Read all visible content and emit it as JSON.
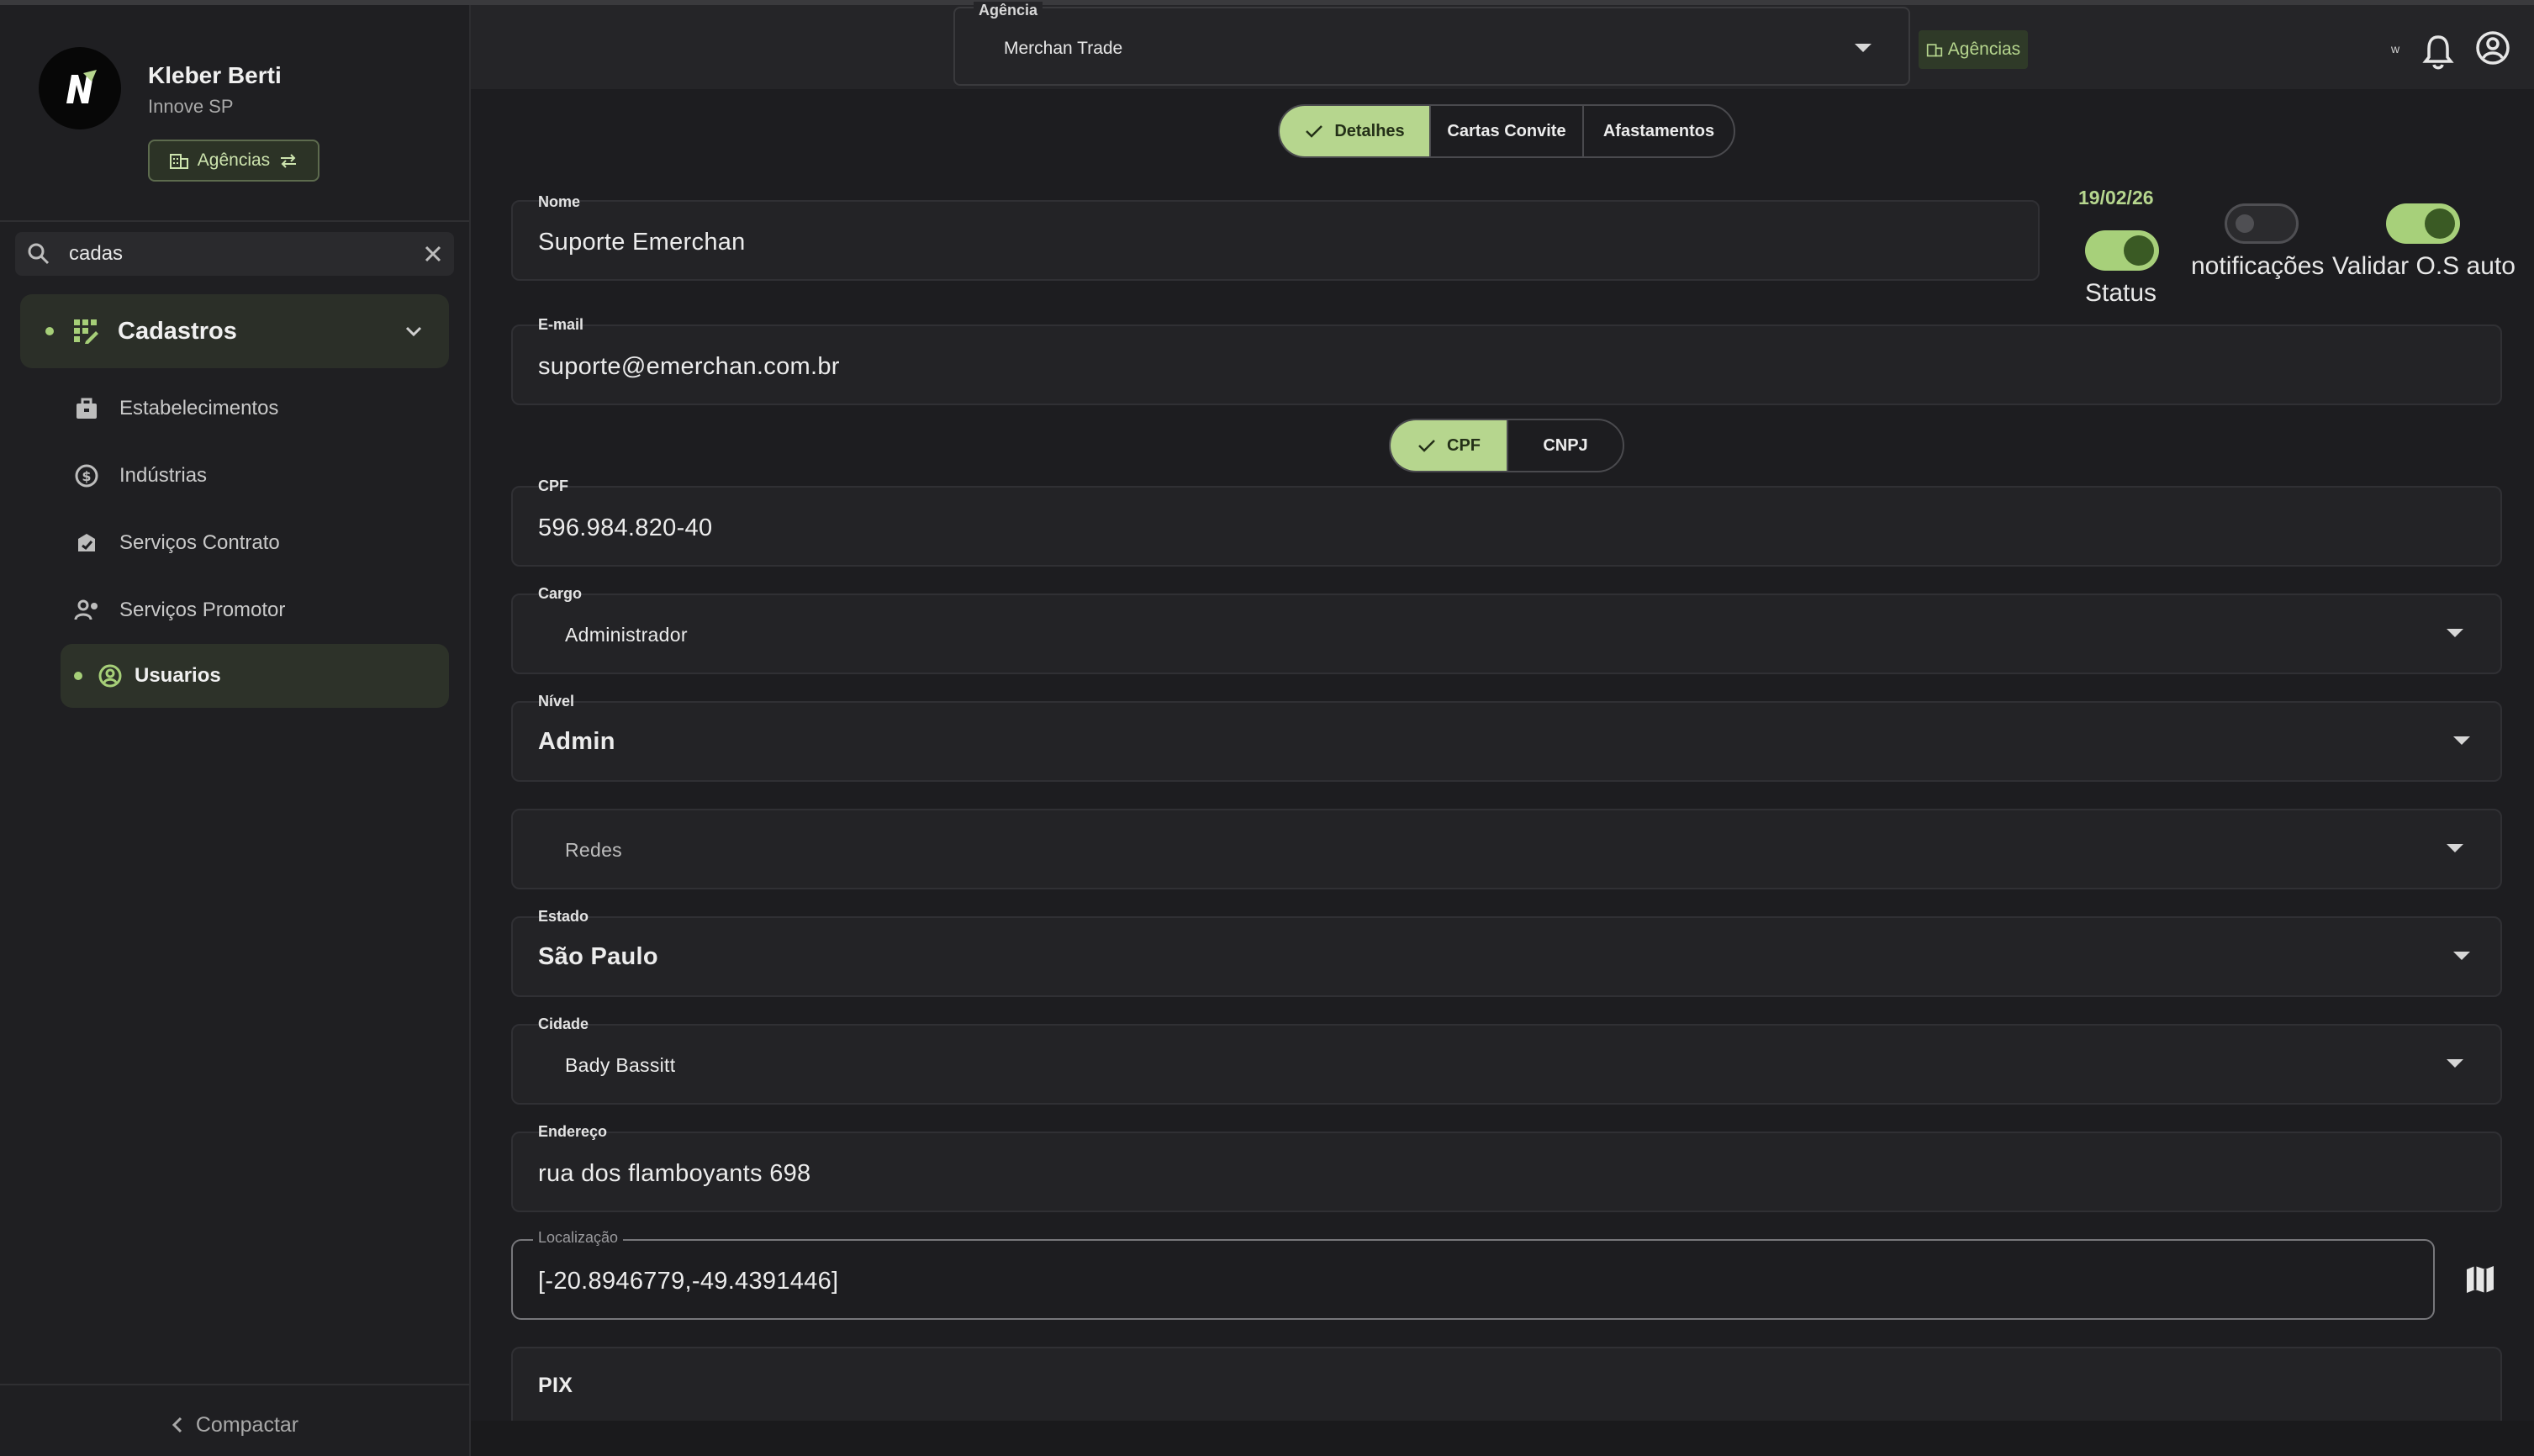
{
  "sidebar": {
    "user_name": "Kleber Berti",
    "user_org": "Innove SP",
    "agencias_chip": "Agências",
    "search_value": "cadas",
    "group_label": "Cadastros",
    "items": [
      {
        "label": "Estabelecimentos",
        "icon": "store-icon"
      },
      {
        "label": "Indústrias",
        "icon": "dollar-circle-icon"
      },
      {
        "label": "Serviços Contrato",
        "icon": "contract-icon"
      },
      {
        "label": "Serviços Promotor",
        "icon": "person-gear-icon"
      }
    ],
    "active_item": "Usuarios",
    "compact_label": "Compactar"
  },
  "header": {
    "agencia_label": "Agência",
    "agencia_value": "Merchan Trade",
    "agencias_button": "Agências",
    "w_label": "w"
  },
  "tabs": {
    "detalhes": "Detalhes",
    "cartas": "Cartas Convite",
    "afastamentos": "Afastamentos"
  },
  "form": {
    "nome_label": "Nome",
    "nome_value": "Suporte Emerchan",
    "date": "19/02/26",
    "status_label": "Status",
    "status_on": true,
    "notificacoes_label": "notificações",
    "notificacoes_on": false,
    "validar_label": "Validar O.S auto",
    "validar_on": true,
    "email_label": "E-mail",
    "email_value": "suporte@emerchan.com.br",
    "doc_cpf": "CPF",
    "doc_cnpj": "CNPJ",
    "cpf_label": "CPF",
    "cpf_value": "596.984.820-40",
    "cargo_label": "Cargo",
    "cargo_value": "Administrador",
    "nivel_label": "Nível",
    "nivel_value": "Admin",
    "redes_placeholder": "Redes",
    "estado_label": "Estado",
    "estado_value": "São Paulo",
    "cidade_label": "Cidade",
    "cidade_value": "Bady Bassitt",
    "endereco_label": "Endereço",
    "endereco_value": "rua dos flamboyants 698",
    "localizacao_label": "Localização",
    "localizacao_value": "[-20.8946779,-49.4391446]",
    "pix_label": "PIX"
  },
  "colors": {
    "accent": "#b6d68e",
    "accent_dark": "#3a5a24",
    "background": "#1d1d20",
    "sidebar": "#1f1f22"
  }
}
